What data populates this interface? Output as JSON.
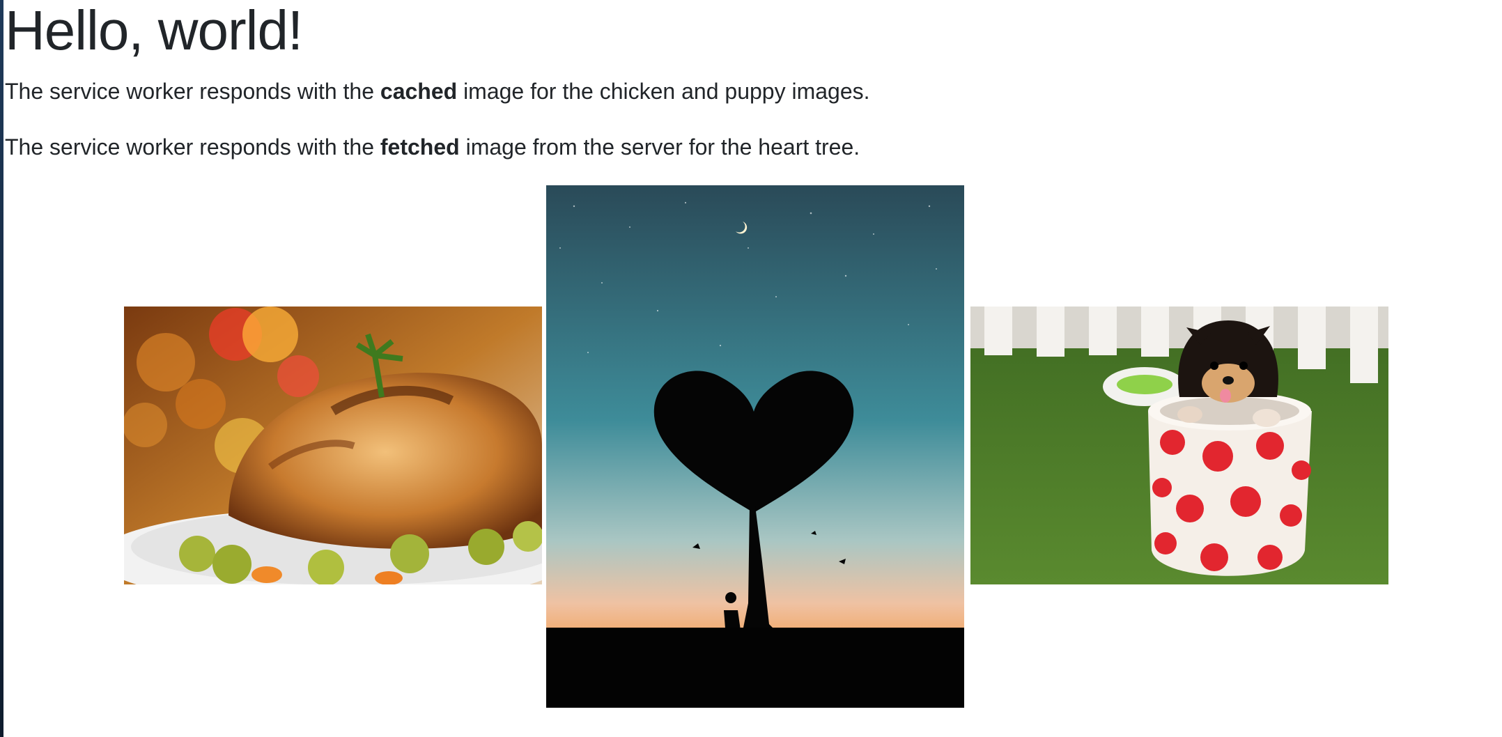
{
  "heading": "Hello, world!",
  "paragraph_cached": {
    "before": "The service worker responds with the ",
    "bold": "cached",
    "after": " image for the chicken and puppy images."
  },
  "paragraph_fetched": {
    "before": "The service worker responds with the ",
    "bold": "fetched",
    "after": " image from the server for the heart tree."
  },
  "images": [
    {
      "name": "chicken-image",
      "subject": "roast chicken on a plate with vegetables"
    },
    {
      "name": "heart-tree-image",
      "subject": "silhouette of a heart-shaped tree under a night sky"
    },
    {
      "name": "puppy-image",
      "subject": "puppy in a polka-dot cup on grass"
    }
  ],
  "colors": {
    "text": "#212529",
    "sky_top": "#2a4d5c",
    "sky_mid": "#3e8c99",
    "sky_horizon": "#f2a35e",
    "grass": "#4f7d2a",
    "cup_dots": "#e2262f"
  }
}
